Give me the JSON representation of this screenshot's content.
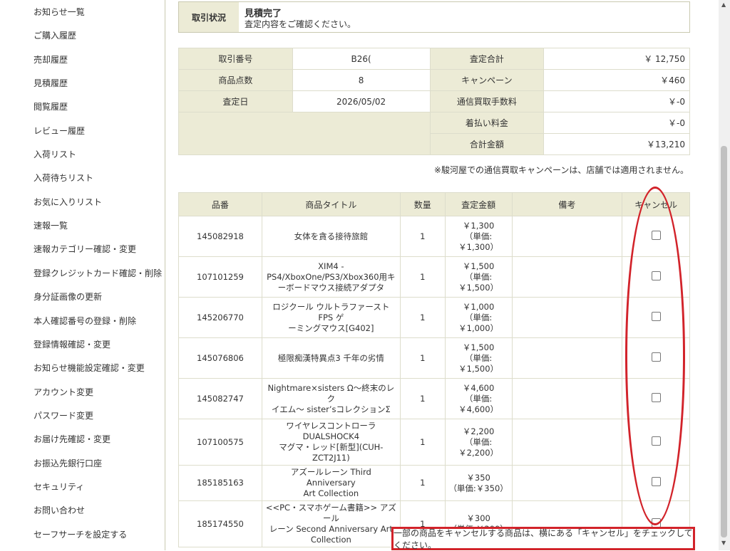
{
  "sidebar": {
    "items": [
      {
        "label": "お知らせ一覧"
      },
      {
        "label": "ご購入履歴"
      },
      {
        "label": "売却履歴"
      },
      {
        "label": "見積履歴"
      },
      {
        "label": "閲覧履歴"
      },
      {
        "label": "レビュー履歴"
      },
      {
        "label": "入荷リスト"
      },
      {
        "label": "入荷待ちリスト"
      },
      {
        "label": "お気に入りリスト"
      },
      {
        "label": "速報一覧"
      },
      {
        "label": "速報カテゴリー確認・変更"
      },
      {
        "label": "登録クレジットカード確認・削除"
      },
      {
        "label": "身分証画像の更新"
      },
      {
        "label": "本人確認番号の登録・削除"
      },
      {
        "label": "登録情報確認・変更"
      },
      {
        "label": "お知らせ機能設定確認・変更"
      },
      {
        "label": "アカウント変更"
      },
      {
        "label": "パスワード変更"
      },
      {
        "label": "お届け先確認・変更"
      },
      {
        "label": "お振込先銀行口座"
      },
      {
        "label": "セキュリティ"
      },
      {
        "label": "お問い合わせ"
      },
      {
        "label": "セーフサーチを設定する"
      }
    ]
  },
  "status": {
    "label": "取引状況",
    "title": "見積完了",
    "description": "査定内容をご確認ください。"
  },
  "summary": {
    "transaction_no_label": "取引番号",
    "transaction_no": "B26(",
    "item_count_label": "商品点数",
    "item_count": "8",
    "appraisal_date_label": "査定日",
    "appraisal_date": "2026/05/02",
    "appraisal_total_label": "査定合計",
    "appraisal_total": "￥ 12,750",
    "campaign_label": "キャンペーン",
    "campaign": "￥460",
    "mail_fee_label": "通信買取手数料",
    "mail_fee": "￥-0",
    "cod_fee_label": "着払い料金",
    "cod_fee": "￥-0",
    "grand_total_label": "合計金額",
    "grand_total": "￥13,210"
  },
  "campaign_note": "※駿河屋での通信買取キャンペーンは、店舗では適用されません。",
  "items_table": {
    "headers": {
      "code": "品番",
      "title": "商品タイトル",
      "qty": "数量",
      "price": "査定金額",
      "note": "備考",
      "cancel": "キャンセル"
    },
    "rows": [
      {
        "code": "145082918",
        "title": [
          "女体を貪る接待旅館"
        ],
        "qty": "1",
        "price": [
          "￥1,300",
          "（単価:",
          "￥1,300）"
        ]
      },
      {
        "code": "107101259",
        "title": [
          "XIM4 -",
          "PS4/XboxOne/PS3/Xbox360用キ",
          "ーボードマウス接続アダプタ"
        ],
        "qty": "1",
        "price": [
          "￥1,500",
          "（単価:",
          "￥1,500）"
        ]
      },
      {
        "code": "145206770",
        "title": [
          "ロジクール ウルトラファースト FPS ゲ",
          "ーミングマウス[G402]"
        ],
        "qty": "1",
        "price": [
          "￥1,000",
          "（単価:",
          "￥1,000）"
        ]
      },
      {
        "code": "145076806",
        "title": [
          "極限痴漢特異点3 千年の劣情"
        ],
        "qty": "1",
        "price": [
          "￥1,500",
          "（単価:",
          "￥1,500）"
        ]
      },
      {
        "code": "145082747",
        "title": [
          "Nightmare×sisters Ω～終末のレク",
          "イエム～ sister’sコレクションΣ"
        ],
        "qty": "1",
        "price": [
          "￥4,600",
          "（単価:",
          "￥4,600）"
        ]
      },
      {
        "code": "107100575",
        "title": [
          "ワイヤレスコントローラDUALSHOCK4",
          "マグマ・レッド[新型](CUH-ZCT2J11)"
        ],
        "qty": "1",
        "price": [
          "￥2,200",
          "（単価:",
          "￥2,200）"
        ]
      },
      {
        "code": "185185163",
        "title": [
          "アズールレーン Third Anniversary",
          "Art Collection"
        ],
        "qty": "1",
        "price": [
          "￥350",
          "（単価:￥350）"
        ]
      },
      {
        "code": "185174550",
        "title": [
          "<<PC・スマホゲーム書籍>> アズール",
          "レーン Second Anniversary Art",
          "Collection"
        ],
        "qty": "1",
        "price": [
          "￥300",
          "（単価:￥300）"
        ]
      }
    ]
  },
  "cancel_instruction": "一部の商品をキャンセルする商品は、横にある「キャンセル」をチェックしてください。",
  "colors": {
    "header_bg": "#ecebd6",
    "border": "#ddddcc",
    "annotation_red": "#d2232a"
  }
}
